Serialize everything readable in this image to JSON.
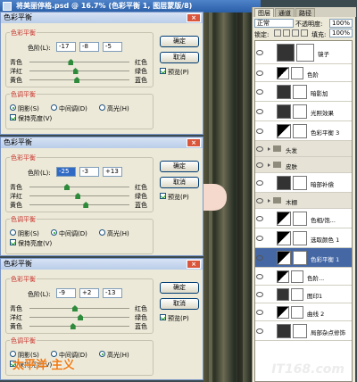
{
  "window": {
    "title": "将美丽停格.psd @ 16.7% (色彩平衡 1, 图层蒙版/8)"
  },
  "dialogs": [
    {
      "title": "色彩平衡",
      "group_label": "色彩平衡",
      "levels_label": "色阶(L):",
      "levels": [
        "-17",
        "-8",
        "-5"
      ],
      "sliders": [
        {
          "left": "青色",
          "right": "红色",
          "value": -17
        },
        {
          "left": "洋红",
          "right": "绿色",
          "value": -8
        },
        {
          "left": "黄色",
          "right": "蓝色",
          "value": -5
        }
      ],
      "tone_label": "色调平衡",
      "radios": [
        "阴影(S)",
        "中间调(D)",
        "高光(H)"
      ],
      "selected": 0,
      "preserve": "保持亮度(V)",
      "ok": "确定",
      "cancel": "取消",
      "preview": "预览(P)"
    },
    {
      "title": "色彩平衡",
      "group_label": "色彩平衡",
      "levels_label": "色阶(L):",
      "levels": [
        "-25",
        "-3",
        "+13"
      ],
      "sliders": [
        {
          "left": "青色",
          "right": "红色",
          "value": -25
        },
        {
          "left": "洋红",
          "right": "绿色",
          "value": -3
        },
        {
          "left": "黄色",
          "right": "蓝色",
          "value": 13
        }
      ],
      "tone_label": "色调平衡",
      "radios": [
        "阴影(S)",
        "中间调(D)",
        "高光(H)"
      ],
      "selected": 1,
      "preserve": "保持亮度(V)",
      "ok": "确定",
      "cancel": "取消",
      "preview": "预览(P)"
    },
    {
      "title": "色彩平衡",
      "group_label": "色彩平衡",
      "levels_label": "色阶(L):",
      "levels": [
        "-9",
        "+2",
        "-13"
      ],
      "sliders": [
        {
          "left": "青色",
          "right": "红色",
          "value": -9
        },
        {
          "left": "洋红",
          "right": "绿色",
          "value": 2
        },
        {
          "left": "黄色",
          "right": "蓝色",
          "value": -13
        }
      ],
      "tone_label": "色调平衡",
      "radios": [
        "阴影(S)",
        "中间调(D)",
        "高光(H)"
      ],
      "selected": 2,
      "preserve": "保持亮度(V)",
      "ok": "确定",
      "cancel": "取消",
      "preview": "预览(P)"
    }
  ],
  "layers_panel": {
    "tabs": [
      "图层",
      "通道",
      "路径"
    ],
    "blend_mode": "正常",
    "opacity_label": "不透明度:",
    "opacity": "100%",
    "lock_label": "锁定:",
    "fill_label": "填充:",
    "fill": "100%",
    "layers": [
      {
        "name": "镜子",
        "type": "layer"
      },
      {
        "name": "色阶",
        "type": "adjust"
      },
      {
        "name": "暗影加",
        "type": "layer"
      },
      {
        "name": "光照效果",
        "type": "layer"
      },
      {
        "name": "色彩平衡 3",
        "type": "adjust"
      },
      {
        "name": "头发",
        "type": "group"
      },
      {
        "name": "皮肤",
        "type": "group"
      },
      {
        "name": "暗部补偿",
        "type": "layer"
      },
      {
        "name": "木棚",
        "type": "group"
      },
      {
        "name": "色相/饱...",
        "type": "adjust"
      },
      {
        "name": "选取颜色 1",
        "type": "adjust"
      },
      {
        "name": "色彩平衡 1",
        "type": "adjust",
        "selected": true
      },
      {
        "name": "色阶...",
        "type": "adjust"
      },
      {
        "name": "图印1",
        "type": "layer"
      },
      {
        "name": "曲线 2",
        "type": "adjust"
      },
      {
        "name": "局部杂点修饰",
        "type": "layer"
      }
    ]
  },
  "logo": "太平洋 主义",
  "watermark": "IT168.com"
}
